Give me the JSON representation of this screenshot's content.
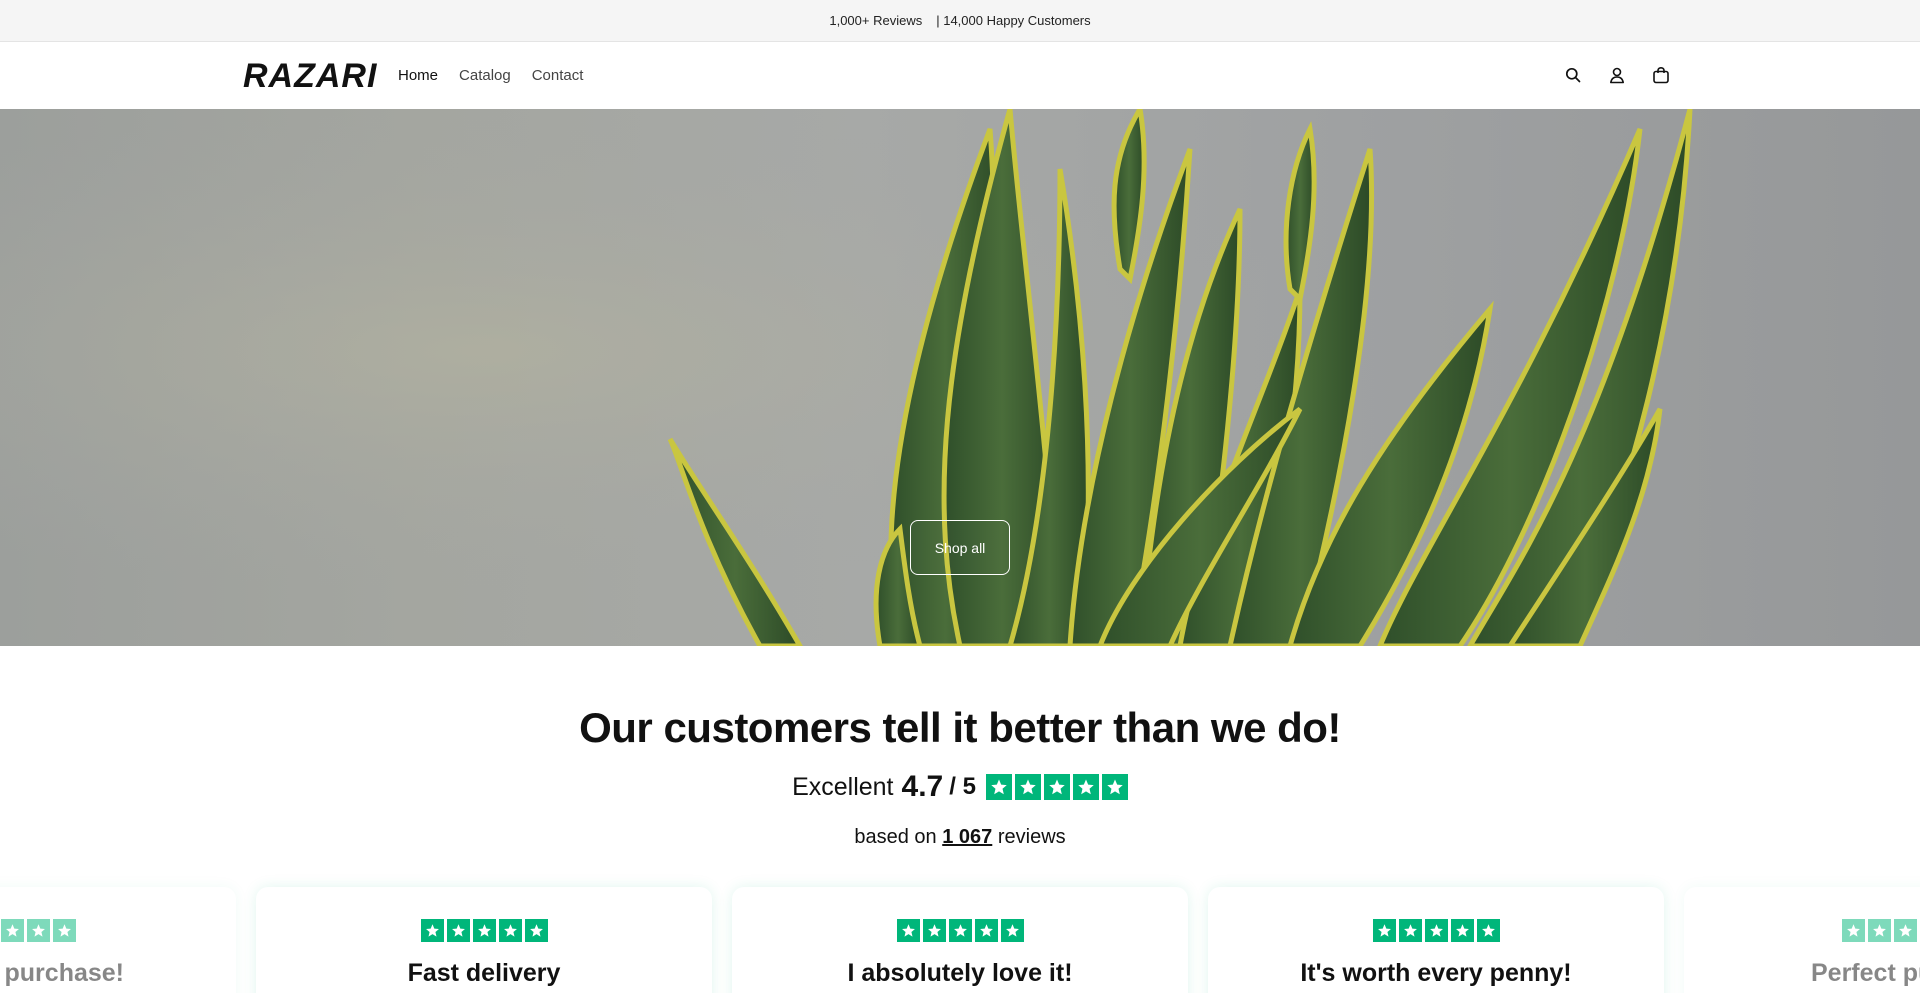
{
  "announcement": {
    "reviews": "1,000+ Reviews",
    "customers": "| 14,000 Happy Customers"
  },
  "header": {
    "logo": "RAZARI",
    "nav": [
      "Home",
      "Catalog",
      "Contact"
    ],
    "icons": [
      "search-icon",
      "account-icon",
      "cart-icon"
    ]
  },
  "hero": {
    "button_label": "Shop all"
  },
  "reviews": {
    "title": "Our customers tell it better than we do!",
    "rating_word": "Excellent",
    "rating_value": "4.7",
    "rating_out_of": "/ 5",
    "based_prefix": "based on",
    "review_count": "1 067",
    "based_suffix": "reviews",
    "star_color": "#00b67a",
    "cards": [
      {
        "title": "purchase!"
      },
      {
        "title": "Fast delivery"
      },
      {
        "title": "I absolutely love it!"
      },
      {
        "title": "It's worth every penny!"
      },
      {
        "title": "Perfect pu"
      }
    ]
  }
}
